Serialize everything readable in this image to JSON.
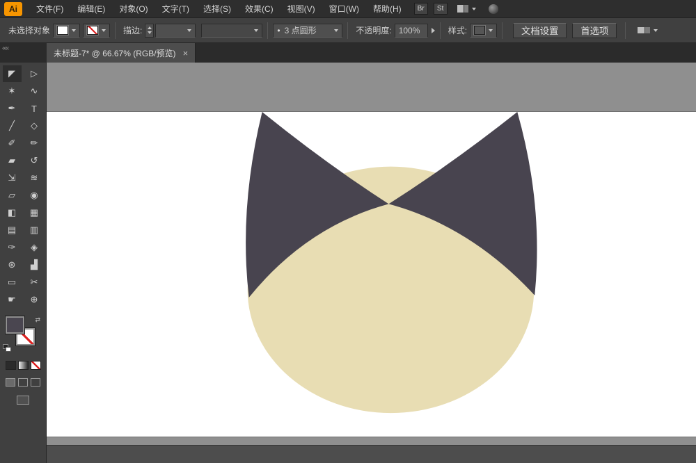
{
  "menu": {
    "logo": "Ai",
    "items": [
      "文件(F)",
      "编辑(E)",
      "对象(O)",
      "文字(T)",
      "选择(S)",
      "效果(C)",
      "视图(V)",
      "窗口(W)",
      "帮助(H)"
    ],
    "badge_bridge": "Br",
    "badge_stock": "St"
  },
  "control": {
    "selection_status": "未选择对象",
    "stroke_label": "描边:",
    "brush_name": "3 点圆形",
    "opacity_label": "不透明度:",
    "opacity_value": "100%",
    "style_label": "样式:",
    "doc_setup_button": "文档设置",
    "preferences_button": "首选项"
  },
  "tab": {
    "title": "未标题-7* @ 66.67% (RGB/预览)"
  },
  "icons": {
    "close": "×",
    "collapse": "««",
    "swap": "⇄",
    "bullet": "•"
  },
  "tools": [
    {
      "name": "selection",
      "glyph": "◤"
    },
    {
      "name": "direct-selection",
      "glyph": "▷"
    },
    {
      "name": "magic-wand",
      "glyph": "✶"
    },
    {
      "name": "lasso",
      "glyph": "∿"
    },
    {
      "name": "pen",
      "glyph": "✒"
    },
    {
      "name": "type",
      "glyph": "T"
    },
    {
      "name": "line-segment",
      "glyph": "╱"
    },
    {
      "name": "shape",
      "glyph": "◇"
    },
    {
      "name": "paintbrush",
      "glyph": "✐"
    },
    {
      "name": "pencil",
      "glyph": "✏"
    },
    {
      "name": "eraser",
      "glyph": "▰"
    },
    {
      "name": "rotate",
      "glyph": "↺"
    },
    {
      "name": "scale",
      "glyph": "⇲"
    },
    {
      "name": "width",
      "glyph": "≋"
    },
    {
      "name": "free-transform",
      "glyph": "▱"
    },
    {
      "name": "shape-builder",
      "glyph": "◉"
    },
    {
      "name": "live-paint",
      "glyph": "◧"
    },
    {
      "name": "perspective-grid",
      "glyph": "▦"
    },
    {
      "name": "mesh",
      "glyph": "▤"
    },
    {
      "name": "gradient",
      "glyph": "▥"
    },
    {
      "name": "eyedropper",
      "glyph": "✑"
    },
    {
      "name": "blend",
      "glyph": "◈"
    },
    {
      "name": "symbol-sprayer",
      "glyph": "⊛"
    },
    {
      "name": "column-graph",
      "glyph": "▟"
    },
    {
      "name": "artboard",
      "glyph": "▭"
    },
    {
      "name": "slice",
      "glyph": "✂"
    },
    {
      "name": "hand",
      "glyph": "☛"
    },
    {
      "name": "zoom",
      "glyph": "⊕"
    }
  ],
  "colors": {
    "head": "#e8ddb3",
    "ears": "#48444f",
    "fill_indicator": "#4a4650",
    "pasteboard": "#8f8f8f",
    "artboard": "#ffffff",
    "none_slash": "#dd2222"
  }
}
